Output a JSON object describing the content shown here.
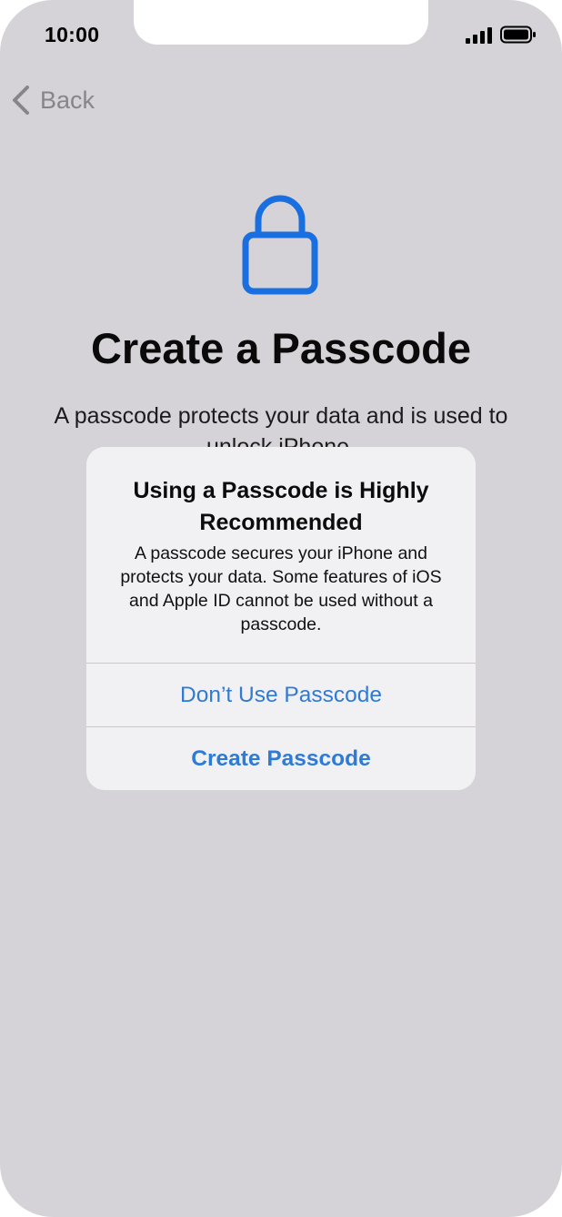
{
  "status_bar": {
    "time": "10:00",
    "signal_icon": "cellular-signal-icon",
    "battery_icon": "battery-icon"
  },
  "nav": {
    "back_label": "Back",
    "back_icon": "chevron-left-icon"
  },
  "main": {
    "icon": "lock-icon",
    "title": "Create a Passcode",
    "description": "A passcode protects your data and is used to unlock iPhone."
  },
  "alert": {
    "title": "Using a Passcode is Highly Recommended",
    "message": "A passcode secures your iPhone and protects your data. Some features of iOS and Apple ID cannot be used without a passcode.",
    "buttons": [
      {
        "label": "Don’t Use Passcode"
      },
      {
        "label": "Create Passcode"
      }
    ]
  },
  "colors": {
    "accent": "#2e7bd6",
    "lock_blue": "#1a6fe0",
    "background": "#d5d3d8",
    "alert_background": "#f1f0f3"
  }
}
